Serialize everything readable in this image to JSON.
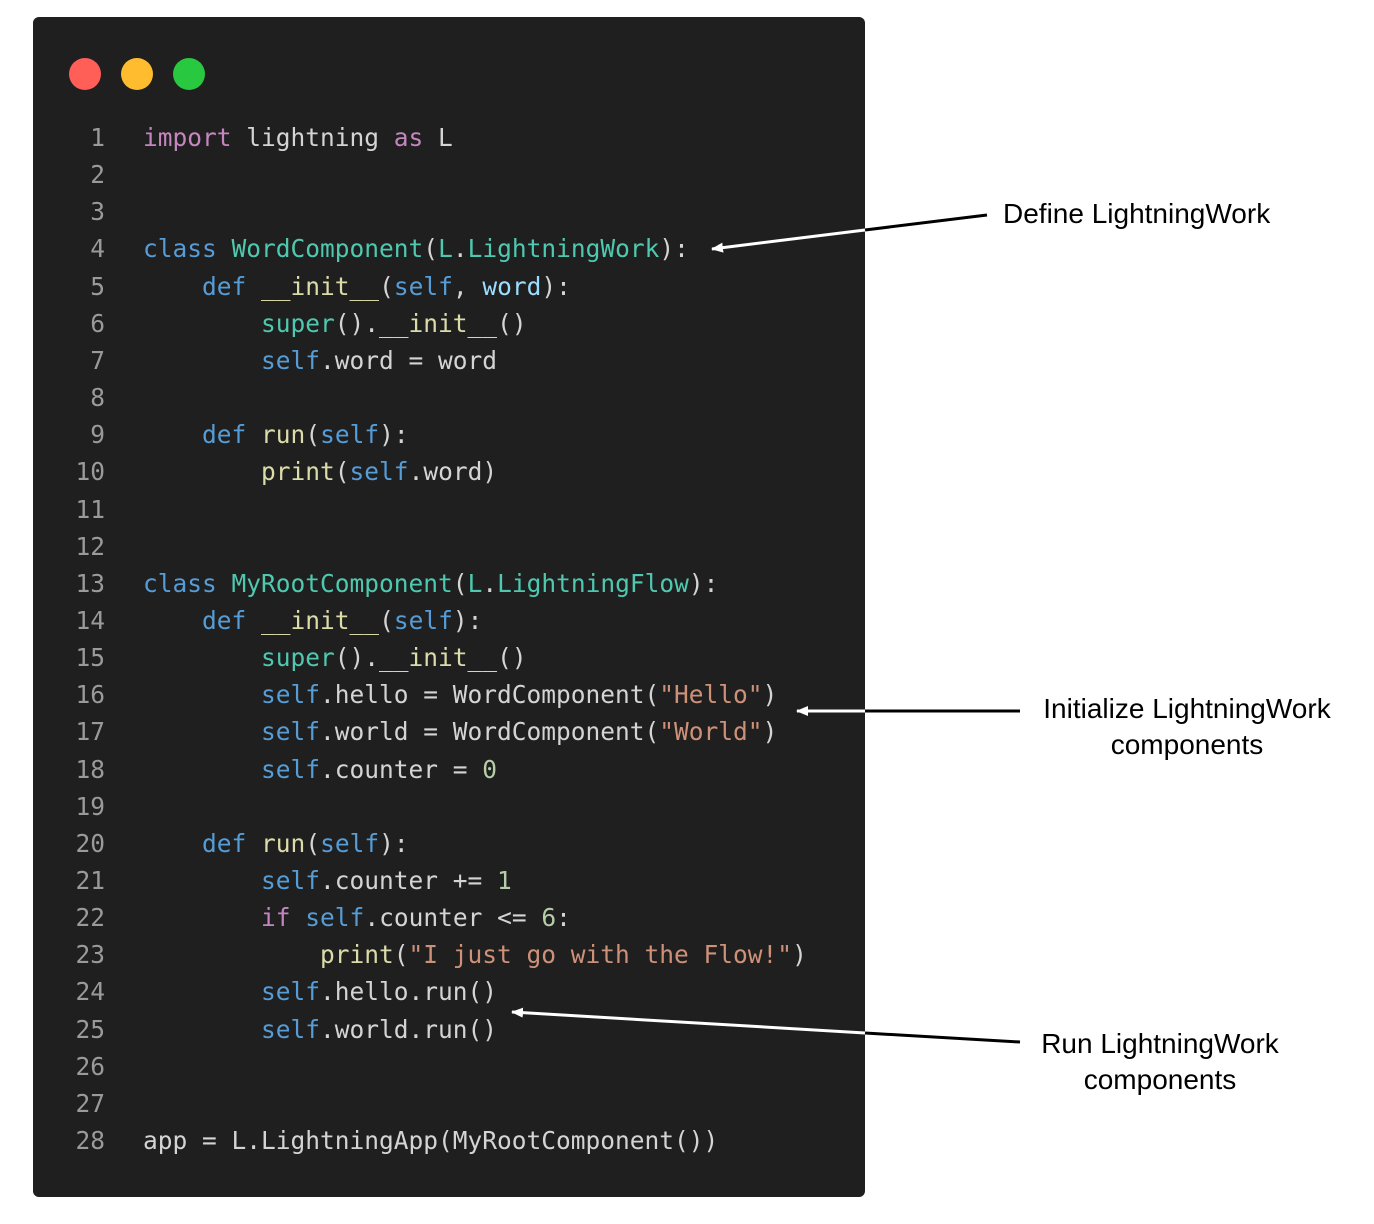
{
  "colors": {
    "window_bg": "#1f1f1f",
    "close": "#ff5f57",
    "minimize": "#febc2e",
    "maximize": "#28c840",
    "keyword": "#c586c0",
    "storage": "#569cd6",
    "class_name": "#4ec9b0",
    "function": "#dcdcaa",
    "string": "#ce9178",
    "number": "#b5cea8",
    "plain": "#d4d4d4",
    "line_number": "#9a9a9a"
  },
  "code": {
    "lines": [
      {
        "n": "1",
        "tokens": [
          [
            "kw",
            "import"
          ],
          [
            "plain",
            " lightning "
          ],
          [
            "kw",
            "as"
          ],
          [
            "plain",
            " L"
          ]
        ]
      },
      {
        "n": "2",
        "tokens": []
      },
      {
        "n": "3",
        "tokens": []
      },
      {
        "n": "4",
        "tokens": [
          [
            "storage",
            "class"
          ],
          [
            "plain",
            " "
          ],
          [
            "cls",
            "WordComponent"
          ],
          [
            "plain",
            "("
          ],
          [
            "cls",
            "L"
          ],
          [
            "plain",
            "."
          ],
          [
            "cls",
            "LightningWork"
          ],
          [
            "plain",
            "):"
          ]
        ]
      },
      {
        "n": "5",
        "tokens": [
          [
            "plain",
            "    "
          ],
          [
            "storage",
            "def"
          ],
          [
            "plain",
            " "
          ],
          [
            "fn",
            "__init__"
          ],
          [
            "plain",
            "("
          ],
          [
            "self",
            "self"
          ],
          [
            "plain",
            ", "
          ],
          [
            "param",
            "word"
          ],
          [
            "plain",
            "):"
          ]
        ]
      },
      {
        "n": "6",
        "tokens": [
          [
            "plain",
            "        "
          ],
          [
            "cls",
            "super"
          ],
          [
            "plain",
            "()."
          ],
          [
            "fn",
            "__init__"
          ],
          [
            "plain",
            "()"
          ]
        ]
      },
      {
        "n": "7",
        "tokens": [
          [
            "plain",
            "        "
          ],
          [
            "self",
            "self"
          ],
          [
            "plain",
            ".word = word"
          ]
        ]
      },
      {
        "n": "8",
        "tokens": []
      },
      {
        "n": "9",
        "tokens": [
          [
            "plain",
            "    "
          ],
          [
            "storage",
            "def"
          ],
          [
            "plain",
            " "
          ],
          [
            "fn",
            "run"
          ],
          [
            "plain",
            "("
          ],
          [
            "self",
            "self"
          ],
          [
            "plain",
            "):"
          ]
        ]
      },
      {
        "n": "10",
        "tokens": [
          [
            "plain",
            "        "
          ],
          [
            "fn",
            "print"
          ],
          [
            "plain",
            "("
          ],
          [
            "self",
            "self"
          ],
          [
            "plain",
            ".word)"
          ]
        ]
      },
      {
        "n": "11",
        "tokens": []
      },
      {
        "n": "12",
        "tokens": []
      },
      {
        "n": "13",
        "tokens": [
          [
            "storage",
            "class"
          ],
          [
            "plain",
            " "
          ],
          [
            "cls",
            "MyRootComponent"
          ],
          [
            "plain",
            "("
          ],
          [
            "cls",
            "L"
          ],
          [
            "plain",
            "."
          ],
          [
            "cls",
            "LightningFlow"
          ],
          [
            "plain",
            "):"
          ]
        ]
      },
      {
        "n": "14",
        "tokens": [
          [
            "plain",
            "    "
          ],
          [
            "storage",
            "def"
          ],
          [
            "plain",
            " "
          ],
          [
            "fn",
            "__init__"
          ],
          [
            "plain",
            "("
          ],
          [
            "self",
            "self"
          ],
          [
            "plain",
            "):"
          ]
        ]
      },
      {
        "n": "15",
        "tokens": [
          [
            "plain",
            "        "
          ],
          [
            "cls",
            "super"
          ],
          [
            "plain",
            "()."
          ],
          [
            "fn",
            "__init__"
          ],
          [
            "plain",
            "()"
          ]
        ]
      },
      {
        "n": "16",
        "tokens": [
          [
            "plain",
            "        "
          ],
          [
            "self",
            "self"
          ],
          [
            "plain",
            ".hello = WordComponent("
          ],
          [
            "str",
            "\"Hello\""
          ],
          [
            "plain",
            ")"
          ]
        ]
      },
      {
        "n": "17",
        "tokens": [
          [
            "plain",
            "        "
          ],
          [
            "self",
            "self"
          ],
          [
            "plain",
            ".world = WordComponent("
          ],
          [
            "str",
            "\"World\""
          ],
          [
            "plain",
            ")"
          ]
        ]
      },
      {
        "n": "18",
        "tokens": [
          [
            "plain",
            "        "
          ],
          [
            "self",
            "self"
          ],
          [
            "plain",
            ".counter = "
          ],
          [
            "num",
            "0"
          ]
        ]
      },
      {
        "n": "19",
        "tokens": []
      },
      {
        "n": "20",
        "tokens": [
          [
            "plain",
            "    "
          ],
          [
            "storage",
            "def"
          ],
          [
            "plain",
            " "
          ],
          [
            "fn",
            "run"
          ],
          [
            "plain",
            "("
          ],
          [
            "self",
            "self"
          ],
          [
            "plain",
            "):"
          ]
        ]
      },
      {
        "n": "21",
        "tokens": [
          [
            "plain",
            "        "
          ],
          [
            "self",
            "self"
          ],
          [
            "plain",
            ".counter += "
          ],
          [
            "num",
            "1"
          ]
        ]
      },
      {
        "n": "22",
        "tokens": [
          [
            "plain",
            "        "
          ],
          [
            "kw",
            "if"
          ],
          [
            "plain",
            " "
          ],
          [
            "self",
            "self"
          ],
          [
            "plain",
            ".counter <= "
          ],
          [
            "num",
            "6"
          ],
          [
            "plain",
            ":"
          ]
        ]
      },
      {
        "n": "23",
        "tokens": [
          [
            "plain",
            "            "
          ],
          [
            "fn",
            "print"
          ],
          [
            "plain",
            "("
          ],
          [
            "str",
            "\"I just go with the Flow!\""
          ],
          [
            "plain",
            ")"
          ]
        ]
      },
      {
        "n": "24",
        "tokens": [
          [
            "plain",
            "        "
          ],
          [
            "self",
            "self"
          ],
          [
            "plain",
            ".hello.run()"
          ]
        ]
      },
      {
        "n": "25",
        "tokens": [
          [
            "plain",
            "        "
          ],
          [
            "self",
            "self"
          ],
          [
            "plain",
            ".world.run()"
          ]
        ]
      },
      {
        "n": "26",
        "tokens": []
      },
      {
        "n": "27",
        "tokens": []
      },
      {
        "n": "28",
        "tokens": [
          [
            "plain",
            "app = L.LightningApp(MyRootComponent())"
          ]
        ]
      }
    ]
  },
  "annotations": {
    "define_work": "Define LightningWork",
    "init_work_line1": "Initialize LightningWork",
    "init_work_line2": "components",
    "run_work_line1": "Run LightningWork",
    "run_work_line2": "components"
  }
}
